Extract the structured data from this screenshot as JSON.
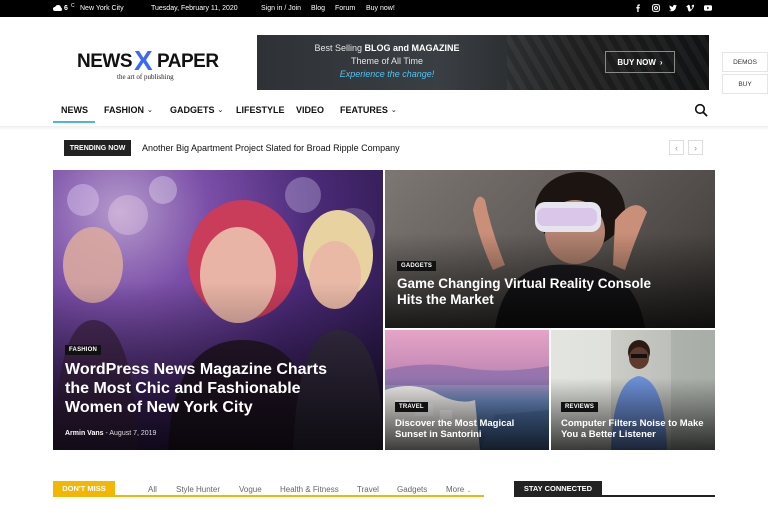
{
  "topbar": {
    "temperature": "6",
    "temp_unit": "C",
    "city": "New York City",
    "date": "Tuesday, February 11, 2020",
    "links": [
      "Sign in / Join",
      "Blog",
      "Forum",
      "Buy now!"
    ],
    "socials": [
      "facebook-icon",
      "instagram-icon",
      "twitter-icon",
      "vimeo-icon",
      "youtube-icon"
    ]
  },
  "logo": {
    "word1": "NEWS",
    "letter": "X",
    "word2": "PAPER",
    "tagline": "the art of publishing"
  },
  "banner": {
    "line1_prefix": "Best Selling ",
    "line1_bold": "BLOG and MAGAZINE",
    "line2": "Theme of All Time",
    "line3": "Experience the change!",
    "button": "BUY NOW",
    "button_arrow": "›"
  },
  "side_buttons": [
    "DEMOS",
    "BUY"
  ],
  "nav": {
    "items": [
      {
        "label": "NEWS",
        "chevron": ""
      },
      {
        "label": "FASHION",
        "chevron": "⌄"
      },
      {
        "label": "GADGETS",
        "chevron": "⌄"
      },
      {
        "label": "LIFESTYLE",
        "chevron": ""
      },
      {
        "label": "VIDEO",
        "chevron": ""
      },
      {
        "label": "FEATURES",
        "chevron": "⌄"
      }
    ],
    "active": "NEWS"
  },
  "trending": {
    "label": "TRENDING NOW",
    "headline": "Another Big Apartment Project Slated for Broad Ripple Company",
    "prev": "‹",
    "next": "›"
  },
  "featured": [
    {
      "category": "FASHION",
      "title": "WordPress News Magazine Charts the Most Chic and Fashionable Women of New York City",
      "author": "Armin Vans",
      "date": "August 7, 2019"
    },
    {
      "category": "GADGETS",
      "title": "Game Changing Virtual Reality Console Hits the Market"
    },
    {
      "category": "TRAVEL",
      "title": "Discover the Most Magical Sunset in Santorini"
    },
    {
      "category": "REVIEWS",
      "title": "Computer Filters Noise to Make You a Better Listener"
    }
  ],
  "dont_miss": {
    "label": "DON'T MISS",
    "filters": [
      "All",
      "Style Hunter",
      "Vogue",
      "Health & Fitness",
      "Travel",
      "Gadgets",
      "More"
    ]
  },
  "stay_connected": {
    "label": "STAY CONNECTED"
  },
  "colors": {
    "accent": "#4db2ec",
    "dont_miss": "#f2b705",
    "logo_x": "#3c6bf2"
  }
}
